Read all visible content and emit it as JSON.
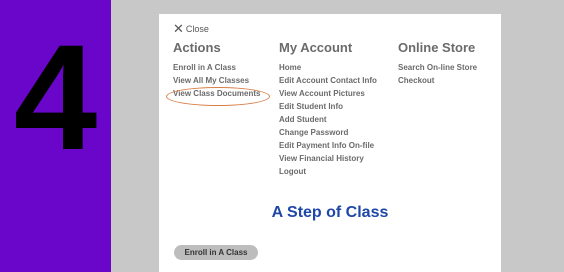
{
  "step": {
    "number": "4"
  },
  "close": {
    "label": "Close",
    "icon": "close-icon"
  },
  "columns": {
    "actions": {
      "heading": "Actions",
      "items": [
        "Enroll in A Class",
        "View All My Classes",
        "View Class Documents"
      ]
    },
    "account": {
      "heading": "My Account",
      "items": [
        "Home",
        "Edit Account Contact Info",
        "View Account Pictures",
        "Edit Student Info",
        "Add Student",
        "Change Password",
        "Edit Payment Info On-file",
        "View Financial History",
        "Logout"
      ]
    },
    "store": {
      "heading": "Online Store",
      "items": [
        "Search On-line Store",
        "Checkout"
      ]
    }
  },
  "highlighted_item": "View Class Documents",
  "page_title": "A Step of Class",
  "enroll_button": {
    "label": "Enroll in A Class"
  },
  "colors": {
    "step_panel": "#6a06c9",
    "highlight_ring": "#d9804a",
    "title": "#1f47a8"
  }
}
